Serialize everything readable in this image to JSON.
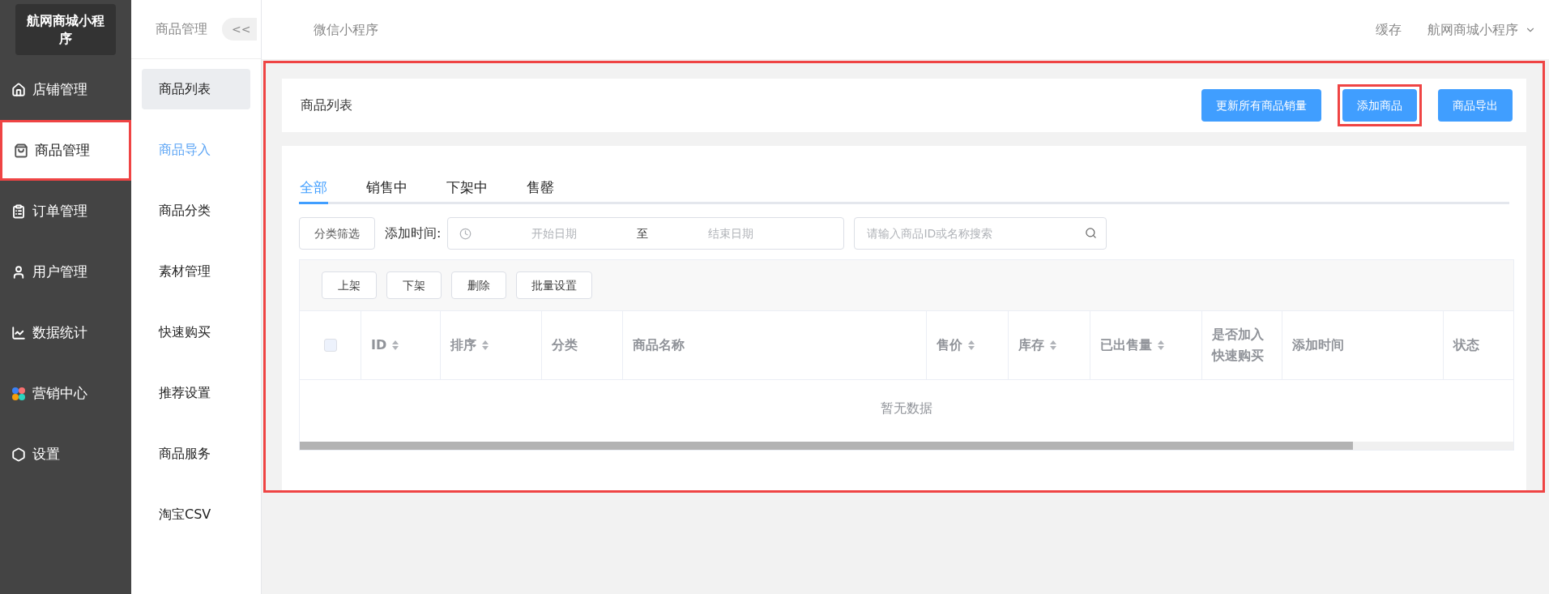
{
  "sidebar": {
    "logo": "航网商城小程序",
    "items": [
      {
        "label": "店铺管理",
        "selected": false
      },
      {
        "label": "商品管理",
        "selected": true
      },
      {
        "label": "订单管理",
        "selected": false
      },
      {
        "label": "用户管理",
        "selected": false
      },
      {
        "label": "数据统计",
        "selected": false
      },
      {
        "label": "营销中心",
        "selected": false
      },
      {
        "label": "设置",
        "selected": false
      }
    ]
  },
  "submenu": {
    "title": "商品管理",
    "collapse": "<<",
    "items": [
      {
        "label": "商品列表",
        "selected": true,
        "hovered": false
      },
      {
        "label": "商品导入",
        "selected": false,
        "hovered": true
      },
      {
        "label": "商品分类",
        "selected": false,
        "hovered": false
      },
      {
        "label": "素材管理",
        "selected": false,
        "hovered": false
      },
      {
        "label": "快速购买",
        "selected": false,
        "hovered": false
      },
      {
        "label": "推荐设置",
        "selected": false,
        "hovered": false
      },
      {
        "label": "商品服务",
        "selected": false,
        "hovered": false
      },
      {
        "label": "淘宝CSV",
        "selected": false,
        "hovered": false
      }
    ]
  },
  "topbar": {
    "title": "微信小程序",
    "cache": "缓存",
    "account": "航网商城小程序"
  },
  "page_header": {
    "title": "商品列表",
    "buttons": [
      {
        "label": "更新所有商品销量",
        "highlighted": false
      },
      {
        "label": "添加商品",
        "highlighted": true
      },
      {
        "label": "商品导出",
        "highlighted": false
      }
    ]
  },
  "tabs": [
    {
      "label": "全部",
      "selected": true
    },
    {
      "label": "销售中",
      "selected": false
    },
    {
      "label": "下架中",
      "selected": false
    },
    {
      "label": "售罄",
      "selected": false
    }
  ],
  "filters": {
    "category_button": "分类筛选",
    "date_label": "添加时间:",
    "start_placeholder": "开始日期",
    "separator": "至",
    "end_placeholder": "结束日期",
    "search_placeholder": "请输入商品ID或名称搜索"
  },
  "bulk_actions": [
    "上架",
    "下架",
    "删除",
    "批量设置"
  ],
  "table": {
    "select_all_checked": false,
    "columns": [
      {
        "label": "ID",
        "sortable": true
      },
      {
        "label": "排序",
        "sortable": true
      },
      {
        "label": "分类",
        "sortable": false
      },
      {
        "label": "商品名称",
        "sortable": false
      },
      {
        "label": "售价",
        "sortable": true
      },
      {
        "label": "库存",
        "sortable": true
      },
      {
        "label": "已出售量",
        "sortable": true
      },
      {
        "label": "是否加入快速购买",
        "sortable": false
      },
      {
        "label": "添加时间",
        "sortable": false
      },
      {
        "label": "状态",
        "sortable": false
      }
    ],
    "empty_text": "暂无数据"
  }
}
